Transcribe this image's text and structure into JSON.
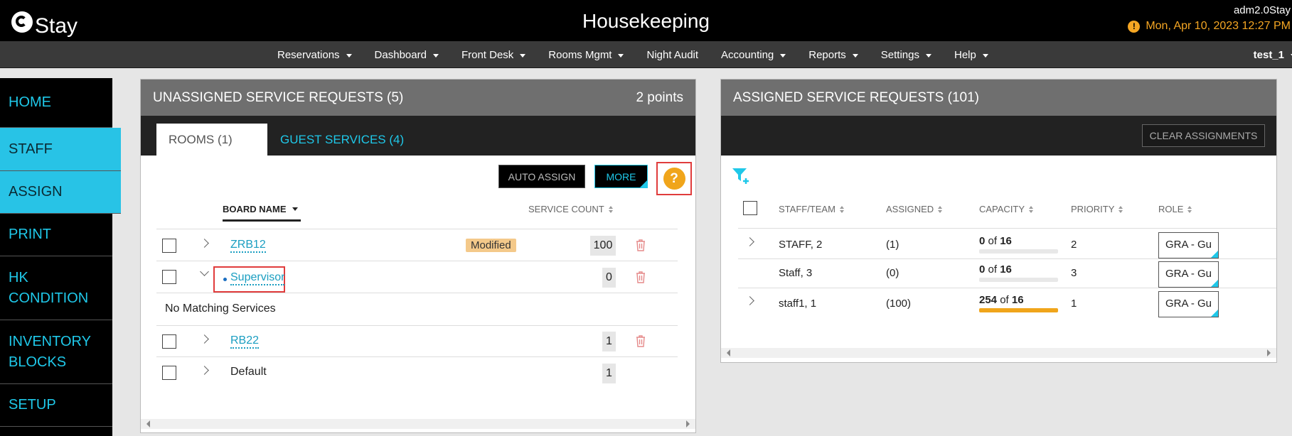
{
  "header": {
    "logo_text": "Stay",
    "title": "Housekeeping",
    "user": "adm2.0Stay",
    "datetime": "Mon, Apr 10, 2023 12:27 PM"
  },
  "nav": {
    "items": [
      "Reservations",
      "Dashboard",
      "Front Desk",
      "Rooms Mgmt",
      "Night Audit",
      "Accounting",
      "Reports",
      "Settings",
      "Help"
    ],
    "user": "test_1"
  },
  "sidebar": {
    "items": [
      {
        "label": "HOME",
        "active": false
      },
      {
        "label": "STAFF",
        "active": true
      },
      {
        "label": "ASSIGN",
        "active": true
      },
      {
        "label": "PRINT",
        "active": false
      },
      {
        "label": "HK CONDITION",
        "active": false
      },
      {
        "label": "INVENTORY BLOCKS",
        "active": false
      },
      {
        "label": "SETUP",
        "active": false
      }
    ]
  },
  "unassigned": {
    "title": "UNASSIGNED SERVICE REQUESTS (5)",
    "points": "2 points",
    "tabs": {
      "rooms": "ROOMS (1)",
      "guest": "GUEST SERVICES (4)"
    },
    "auto_assign": "AUTO ASSIGN",
    "more": "MORE",
    "help": "?",
    "col_board": "BOARD NAME",
    "col_count": "SERVICE COUNT",
    "rows": [
      {
        "name": "ZRB12",
        "badge": "Modified",
        "count": "100"
      },
      {
        "name": "Supervisor",
        "count": "0"
      },
      {
        "name": "RB22",
        "count": "1"
      },
      {
        "name": "Default",
        "count": "1"
      }
    ],
    "no_match": "No Matching Services"
  },
  "assigned": {
    "title": "ASSIGNED SERVICE REQUESTS (101)",
    "clear": "CLEAR ASSIGNMENTS",
    "cols": {
      "staff": "STAFF/TEAM",
      "assigned": "ASSIGNED",
      "capacity": "CAPACITY",
      "priority": "PRIORITY",
      "role": "ROLE"
    },
    "cap_of": "of",
    "rows": [
      {
        "staff": "STAFF, 2",
        "assigned": "(1)",
        "cap_used": "0",
        "cap_total": "16",
        "fill": 0,
        "priority": "2",
        "role": "GRA - Gu"
      },
      {
        "staff": "Staff, 3",
        "assigned": "(0)",
        "cap_used": "0",
        "cap_total": "16",
        "fill": 0,
        "priority": "3",
        "role": "GRA - Gu"
      },
      {
        "staff": "staff1, 1",
        "assigned": "(100)",
        "cap_used": "254",
        "cap_total": "16",
        "fill": 1,
        "priority": "1",
        "role": "GRA - Gu"
      }
    ]
  },
  "colors": {
    "accent": "#1fc8e9",
    "warning": "#f5a623",
    "badge": "#f4c98a",
    "highlight": "#e03c3c"
  }
}
